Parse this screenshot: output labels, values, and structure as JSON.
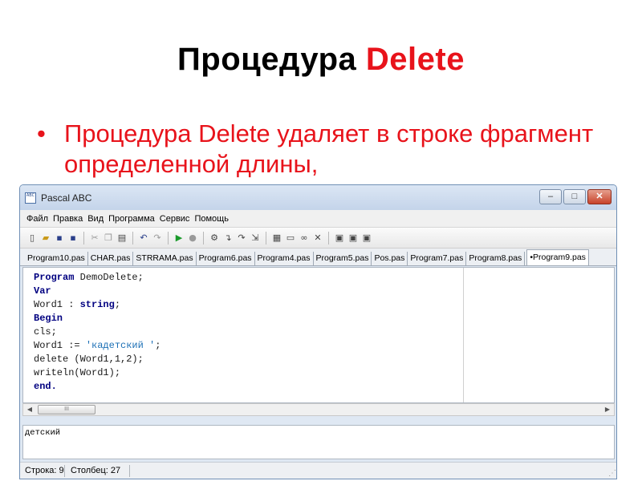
{
  "slide": {
    "title_main": "Процедура ",
    "title_accent": "Delete",
    "bullet_symbol": "•",
    "bullet_text": "Процедура Delete удаляет в строке фрагмент определенной длины,"
  },
  "window": {
    "title": "Pascal ABC",
    "icon_text": "ABC",
    "minimize": "–",
    "maximize": "□",
    "close": "✕"
  },
  "menu": {
    "items": [
      "Файл",
      "Правка",
      "Вид",
      "Программа",
      "Сервис",
      "Помощь"
    ]
  },
  "tabs": {
    "items": [
      "Program10.pas",
      "CHAR.pas",
      "STRRAMA.pas",
      "Program6.pas",
      "Program4.pas",
      "Program5.pas",
      "Pos.pas",
      "Program7.pas",
      "Program8.pas"
    ],
    "active": "•Program9.pas"
  },
  "code": {
    "l1_kw": "Program",
    "l1_rest": " DemoDelete;",
    "l2_kw": "Var",
    "l3_a": "Word1 : ",
    "l3_kw": "string",
    "l3_b": ";",
    "l4_kw": "Begin",
    "l5": "cls;",
    "l6_a": "Word1 := ",
    "l6_str": "'кадетский '",
    "l6_b": ";",
    "l7": "delete  (Word1,1,2);",
    "l8": "writeln(Word1);",
    "l9_kw": "end."
  },
  "scroll": {
    "left": "◀",
    "right": "▶",
    "thumb": "III"
  },
  "output": {
    "text": "детский"
  },
  "status": {
    "line": "Строка: 9",
    "column": "Столбец: 27",
    "grip": "⋰"
  },
  "colors": {
    "accent": "#e8131b",
    "keyword": "#000080",
    "string": "#1b6fb5"
  }
}
